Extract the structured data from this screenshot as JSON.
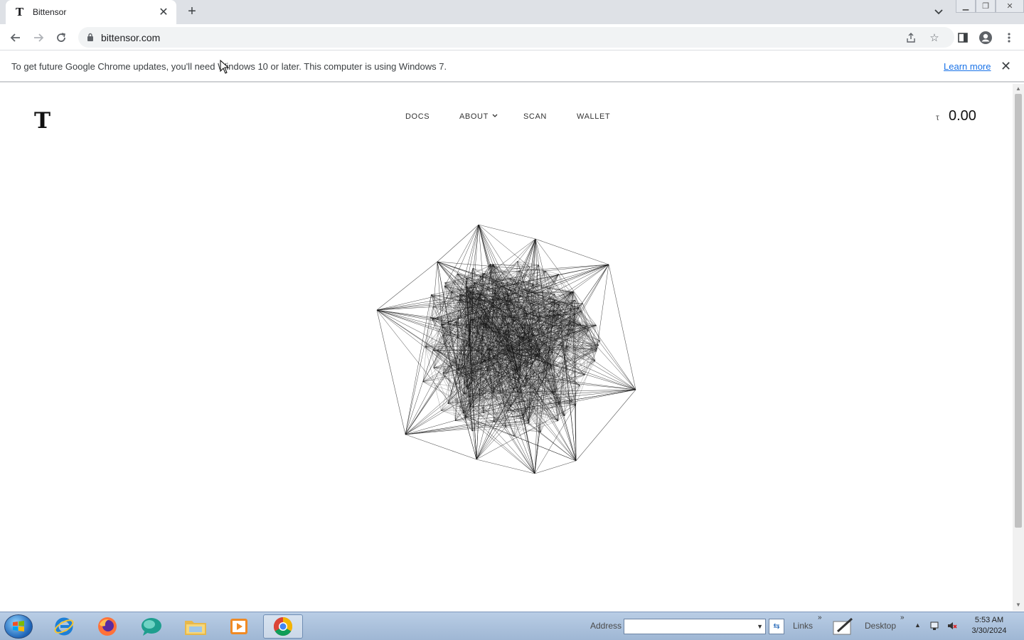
{
  "browser": {
    "tab_title": "Bittensor",
    "tab_favicon": "T",
    "new_tab_glyph": "+",
    "url": "bittensor.com"
  },
  "infobar": {
    "message": "To get future Google Chrome updates, you'll need Windows 10 or later. This computer is using Windows 7.",
    "link": "Learn more"
  },
  "site": {
    "logo": "T",
    "nav": {
      "docs": "DOCS",
      "about": "ABOUT",
      "scan": "SCAN",
      "wallet": "WALLET"
    },
    "balance_symbol": "τ",
    "balance_value": "0.00"
  },
  "taskbar": {
    "address_label": "Address",
    "links_label": "Links",
    "desktop_label": "Desktop",
    "time": "5:53 AM",
    "date": "3/30/2024"
  },
  "colors": {
    "tabstrip": "#dee1e6",
    "link": "#1a73e8",
    "taskbar": "#b9cde5"
  }
}
